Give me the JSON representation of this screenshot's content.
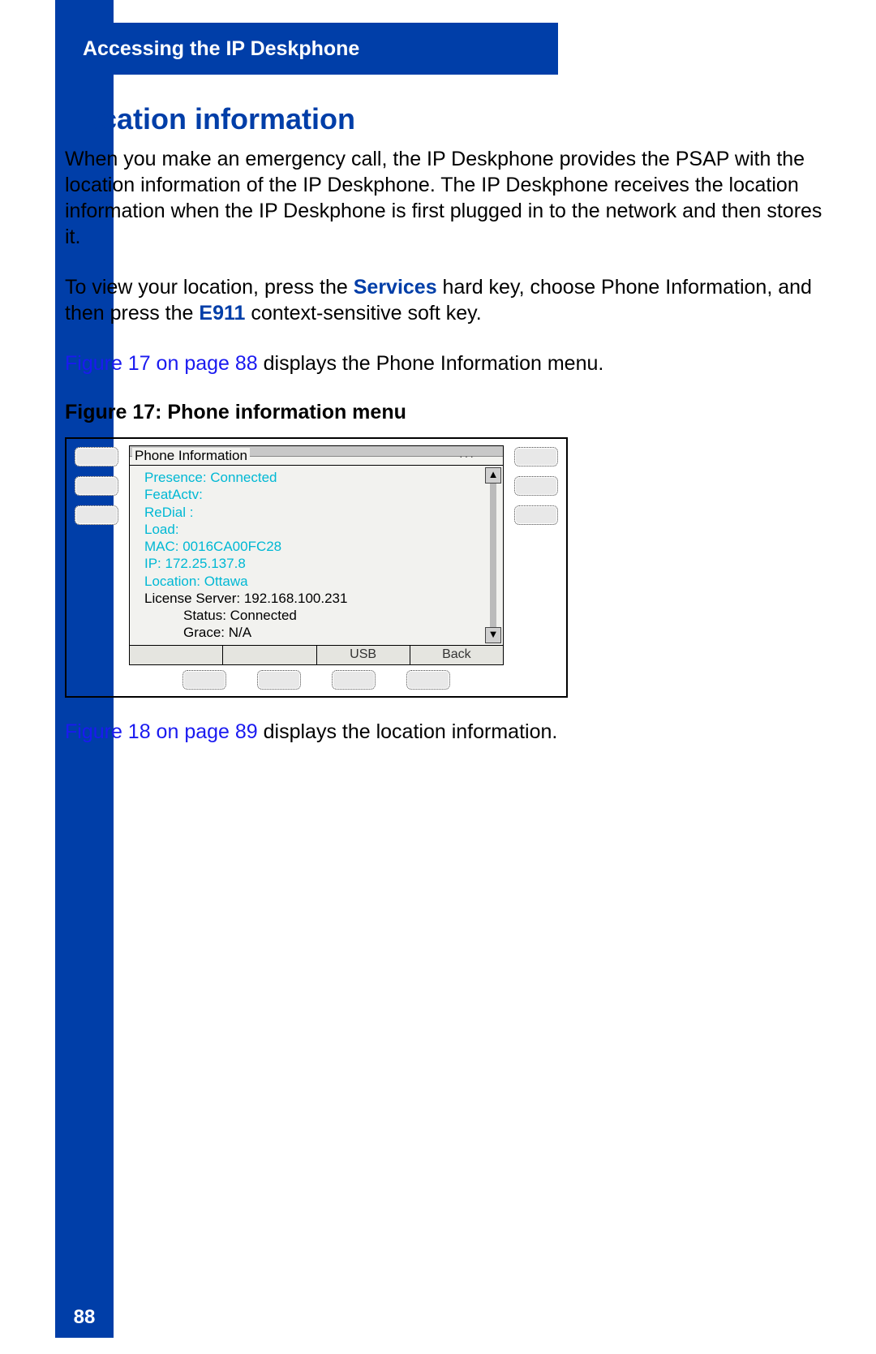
{
  "header": {
    "title": "Accessing the IP Deskphone"
  },
  "page_number": "88",
  "section_title": "Location information",
  "para1": "When you make an emergency call, the IP Deskphone provides the PSAP with the location information of the IP Deskphone. The IP Deskphone receives the location information when the IP Deskphone is first plugged in to the network and then stores it.",
  "para2_a": "To view your location, press the ",
  "para2_services": "Services",
  "para2_b": " hard key, choose Phone Information, and then press the ",
  "para2_e911": "E911",
  "para2_c": " context-sensitive soft key.",
  "para3_link": "Figure 17 on page 88",
  "para3_rest": " displays the Phone Information menu.",
  "fig_caption": "Figure 17: Phone information menu",
  "screen": {
    "title": "Phone Information",
    "lines": {
      "presence": "Presence:  Connected",
      "featactv": "FeatActv:",
      "redial": "ReDial  :",
      "load": "Load:",
      "mac": "MAC:  0016CA00FC28",
      "ip": "IP:  172.25.137.8",
      "location": "Location:  Ottawa",
      "license": "License Server: 192.168.100.231",
      "status": "Status: Connected",
      "grace": "Grace: N/A"
    },
    "softkeys": {
      "k1": "",
      "k2": "",
      "k3": "USB",
      "k4": "Back"
    }
  },
  "para4_link": "Figure 18 on page 89",
  "para4_rest": " displays the location information."
}
